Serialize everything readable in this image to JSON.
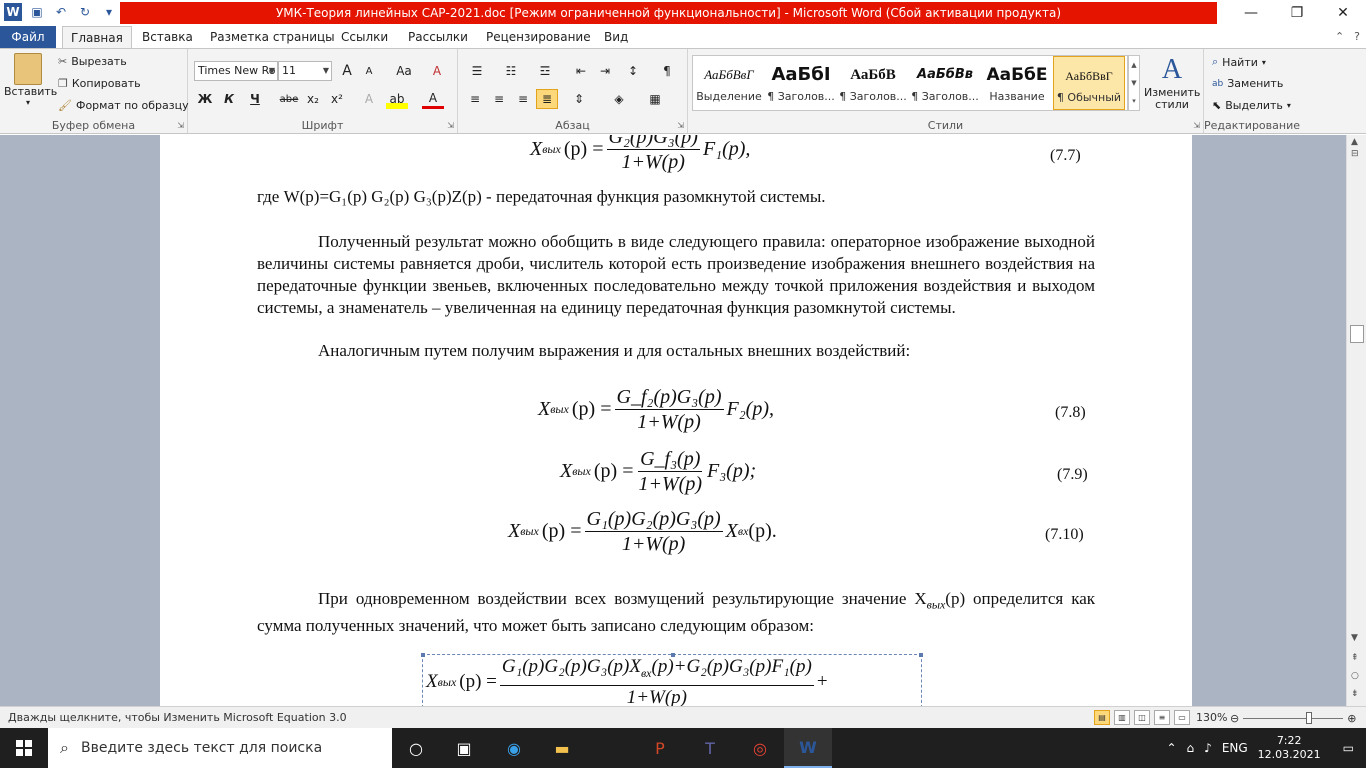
{
  "window": {
    "title": "УМК-Теория линейных САР-2021.doc [Режим ограниченной функциональности]  -  Microsoft Word (Сбой активации продукта)",
    "app_icon": "W",
    "undo_icon": "↶",
    "redo_icon": "↻",
    "save_icon": "💾",
    "minimize": "—",
    "restore": "❐",
    "close": "✕",
    "accent_color": "#2b579a",
    "title_bg_color": "#e51400"
  },
  "tabs": {
    "file": "Файл",
    "items": [
      "Главная",
      "Вставка",
      "Разметка страницы",
      "Ссылки",
      "Рассылки",
      "Рецензирование",
      "Вид"
    ],
    "active": "Главная"
  },
  "ribbon": {
    "clipboard": {
      "label": "Буфер обмена",
      "paste": "Вставить",
      "cut": "Вырезать",
      "copy": "Копировать",
      "format_painter": "Формат по образцу"
    },
    "font": {
      "label": "Шрифт",
      "font_name": "Times New Ro",
      "font_size": "11",
      "grow": "A",
      "shrink": "A",
      "case": "Aa",
      "clear": "A",
      "bold": "Ж",
      "italic": "К",
      "underline": "Ч",
      "strike": "abe",
      "subscript": "x₂",
      "superscript": "x²",
      "text_effects": "A",
      "highlight": "ab",
      "font_color": "A"
    },
    "paragraph": {
      "label": "Абзац"
    },
    "styles": {
      "label": "Стили",
      "items": [
        {
          "sample": "АаБбВвГ",
          "name": "Выделение"
        },
        {
          "sample": "АаБбI",
          "name": "¶ Заголов..."
        },
        {
          "sample": "АаБбВ",
          "name": "¶ Заголов..."
        },
        {
          "sample": "АаБбВв",
          "name": "¶ Заголов..."
        },
        {
          "sample": "АаБбЕ",
          "name": "Название"
        },
        {
          "sample": "АаБбВвГ",
          "name": "¶ Обычный"
        }
      ],
      "selected_index": 5,
      "change_styles": "Изменить стили"
    },
    "editing": {
      "label": "Редактирование",
      "find": "Найти",
      "replace": "Заменить",
      "select": "Выделить"
    }
  },
  "document": {
    "eq77_lhs": "X",
    "eq77_sub": "вых",
    "eq77_num": "G₂(p)G₃(p)",
    "eq77_den": "1+W(p)",
    "eq77_rhs": "F₁(p),",
    "eq77_number": "(7.7)",
    "where_line": "где  W(p)=G₁(p) G₂(p) G₃(p)Z(p) - передаточная функция разомкнутой системы.",
    "paragraph1": "Полученный результат можно обобщить в виде следующего правила: операторное изображение выходной величины системы равняется дроби, числитель которой есть произведение изображения внешнего воздействия на передаточные функции звеньев, включенных последовательно между точкой приложения воздействия и выходом системы, а знаменатель – увеличенная на единицу передаточная функция разомкнутой системы.",
    "paragraph2": "Аналогичным путем получим выражения и для остальных внешних воздействий:",
    "eq78_num": "G_f₂(p)G₃(p)",
    "eq78_den": "1+W(p)",
    "eq78_rhs": "F₂(p),",
    "eq78_number": "(7.8)",
    "eq79_num": "G_f₃(p)",
    "eq79_den": "1+W(p)",
    "eq79_rhs": "F₃(p);",
    "eq79_number": "(7.9)",
    "eq710_num": "G₁(p)G₂(p)G₃(p)",
    "eq710_den": "1+W(p)",
    "eq710_rhs": "X",
    "eq710_rhs_sub": "вх",
    "eq710_rhs_tail": "(p).",
    "eq710_number": "(7.10)",
    "paragraph3": "При одновременном воздействии всех возмущений результирующие значение X",
    "paragraph3_sub": "вых",
    "paragraph3_tail": "(p) определится как сумма полученных значений, что может быть записано следующим образом:",
    "eqlast_num": "G₁(p)G₂(p)G₃(p)X",
    "eqlast_num_sub": "вх",
    "eqlast_num_tail": "(p)+G₂(p)G₃(p)F₁(p)",
    "eqlast_den": "1+W(p)",
    "eqlast_plus": "+",
    "lhs_common": "X",
    "lhs_sub": "вых",
    "lhs_paren": "(p) ="
  },
  "statusbar": {
    "message": "Дважды щелкните, чтобы Изменить Microsoft Equation 3.0",
    "zoom": "130%",
    "zoom_fraction": 0.66
  },
  "taskbar": {
    "search_placeholder": "Введите здесь текст для поиска",
    "language": "ENG",
    "time": "7:22",
    "date": "12.03.2021"
  }
}
